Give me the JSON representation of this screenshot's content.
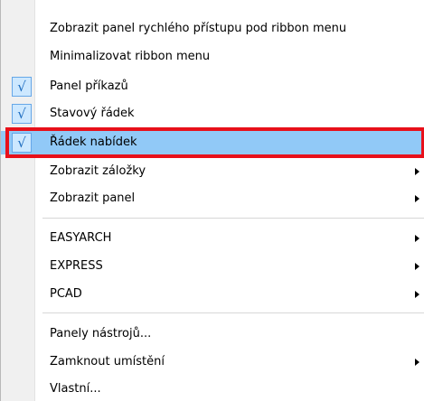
{
  "menu": {
    "items": [
      {
        "label": "Zobrazit panel rychlého přístupu pod ribbon menu",
        "checked": false,
        "submenu": false
      },
      {
        "label": "Minimalizovat ribbon menu",
        "checked": false,
        "submenu": false
      },
      {
        "label": "Panel příkazů",
        "checked": true,
        "submenu": false
      },
      {
        "label": "Stavový řádek",
        "checked": true,
        "submenu": false
      },
      {
        "label": "Řádek nabídek",
        "checked": true,
        "submenu": false,
        "highlighted": true
      },
      {
        "label": "Zobrazit záložky",
        "checked": false,
        "submenu": true
      },
      {
        "label": "Zobrazit panel",
        "checked": false,
        "submenu": true
      },
      {
        "label": "EASYARCH",
        "checked": false,
        "submenu": true
      },
      {
        "label": "EXPRESS",
        "checked": false,
        "submenu": true
      },
      {
        "label": "PCAD",
        "checked": false,
        "submenu": true
      },
      {
        "label": "Panely nástrojů...",
        "checked": false,
        "submenu": false
      },
      {
        "label": "Zamknout umístění",
        "checked": false,
        "submenu": true
      },
      {
        "label": "Vlastní...",
        "checked": false,
        "submenu": false
      }
    ],
    "check_glyph": "√",
    "highlight_color": "#91c9f7",
    "annotation_color": "#e8101a"
  }
}
